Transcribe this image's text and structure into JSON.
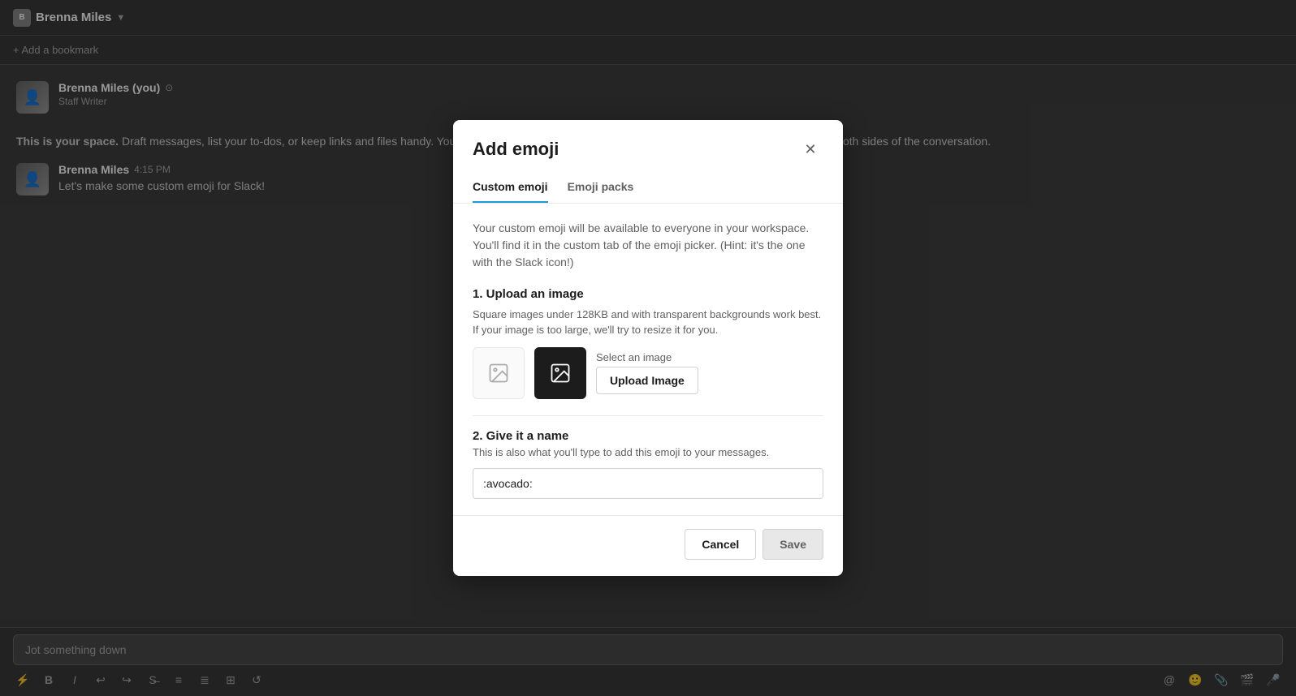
{
  "app": {
    "workspace_name": "Brenna Miles",
    "workspace_initial": "B",
    "bookmark_label": "+ Add a bookmark"
  },
  "chat": {
    "messages": [
      {
        "author": "Brenna Miles (you)",
        "author_name": "Brenna Miles",
        "you_badge": "⊙",
        "sub": "Staff Writer",
        "text_bold": "This is your space.",
        "text": " Draft messages, list your to-dos, or keep links and files handy. You can also talk to yourself here, but please bear in mind you'll have to supply both sides of the conversation."
      },
      {
        "author": "Brenna Miles",
        "time": "4:15 PM",
        "text": "Let's make some custom emoji for Slack!"
      }
    ],
    "input_placeholder": "Jot something down"
  },
  "modal": {
    "title": "Add emoji",
    "tabs": [
      {
        "label": "Custom emoji",
        "active": true
      },
      {
        "label": "Emoji packs",
        "active": false
      }
    ],
    "description": "Your custom emoji will be available to everyone in your workspace. You'll find it in the custom tab of the emoji picker. (Hint: it's the one with the Slack icon!)",
    "section1": {
      "title": "1. Upload an image",
      "subtitle": "Square images under 128KB and with transparent backgrounds work best. If your image is too large, we'll try to resize it for you.",
      "select_label": "Select an image",
      "upload_btn": "Upload Image"
    },
    "section2": {
      "title": "2. Give it a name",
      "description": "This is also what you'll type to add this emoji to your messages.",
      "input_value": ":avocado:",
      "input_placeholder": ":avocado:"
    },
    "footer": {
      "cancel_label": "Cancel",
      "save_label": "Save"
    }
  },
  "toolbar": {
    "icons": [
      "⚡",
      "B",
      "I",
      "↩",
      "↪",
      "S",
      "≡",
      "≣",
      "⊞",
      "↺"
    ]
  }
}
